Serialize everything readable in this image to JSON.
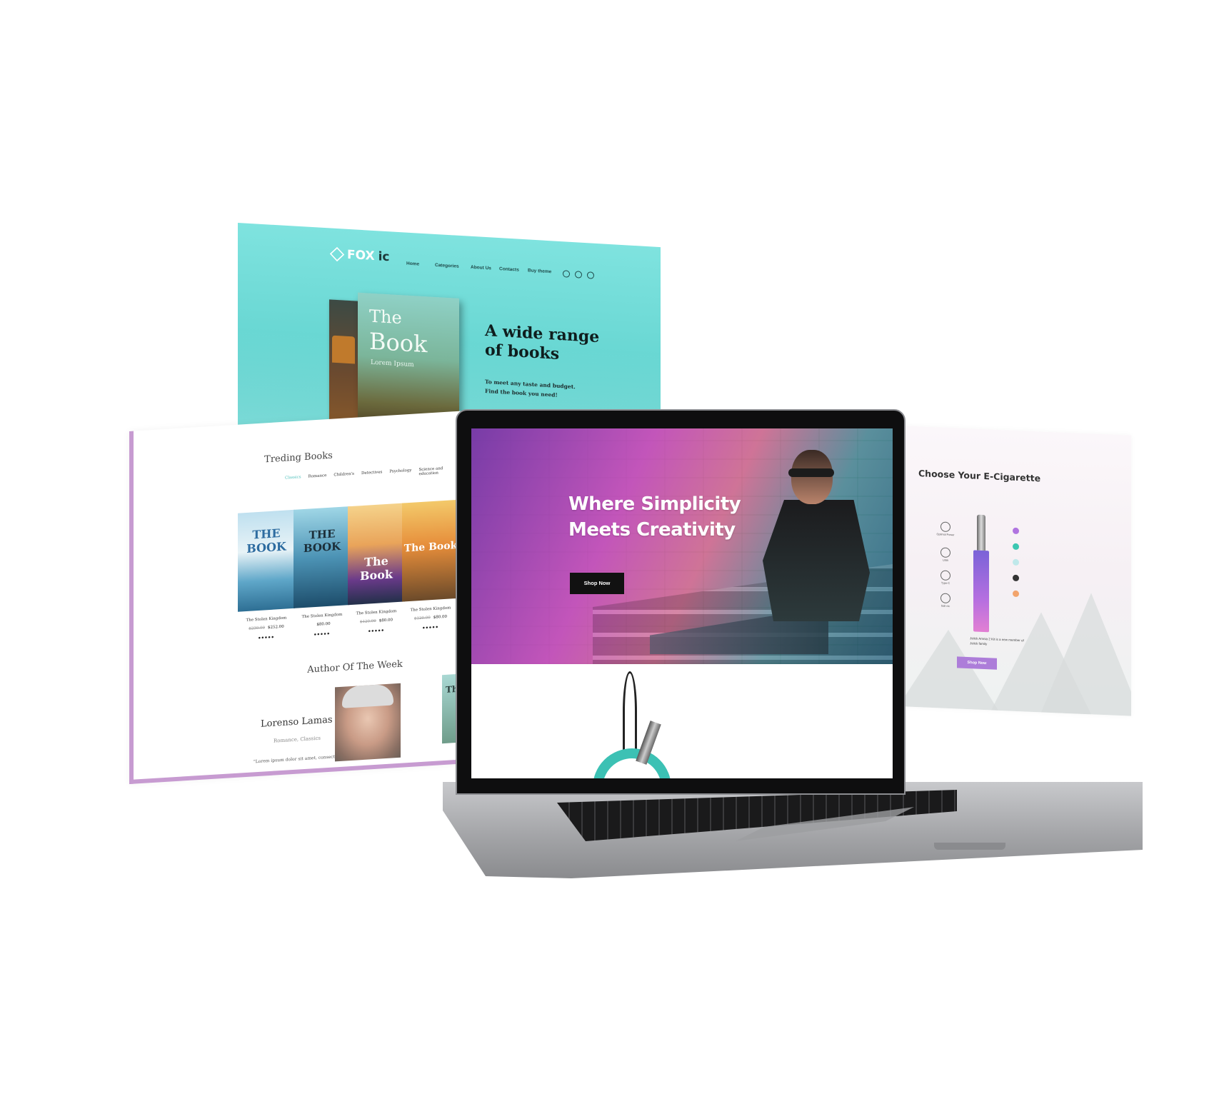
{
  "hero_panel": {
    "logo": {
      "text": "FOX",
      "suffix": "ic"
    },
    "nav": [
      "Home",
      "Categories",
      "About Us",
      "Contacts",
      "Buy theme"
    ],
    "book_cover": {
      "line1": "The",
      "line2": "Book",
      "line3": "Lorem Ipsum"
    },
    "headline_line1": "A wide range",
    "headline_line2": "of books",
    "subtext_line1": "To meet any taste and budget.",
    "subtext_line2": "Find the book you need!",
    "colors": {
      "background": "#67d6d2",
      "headline": "#0f1e1e"
    }
  },
  "books_panel": {
    "title": "Treding Books",
    "categories": [
      "Classics",
      "Romance",
      "Children's",
      "Detectives",
      "Psychology",
      "Science and education"
    ],
    "active_category": "Classics",
    "books": [
      {
        "cover_text": "THE BOOK",
        "name": "The Stolen Kingdom",
        "old_price": "$230.00",
        "price": "$252.00",
        "stars": "●●●●●"
      },
      {
        "cover_text": "THE BOOK",
        "name": "The Stolen Kingdom",
        "old_price": "",
        "price": "$80.00",
        "stars": "●●●●●"
      },
      {
        "cover_text": "The Book",
        "name": "The Stolen Kingdom",
        "old_price": "$120.00",
        "price": "$80.00",
        "stars": "●●●●●"
      },
      {
        "cover_text": "The Book",
        "name": "The Stolen Kingdom",
        "old_price": "$120.00",
        "price": "$80.00",
        "stars": "●●●●●"
      }
    ],
    "author_section_title": "Author Of The Week",
    "author_name": "Lorenso Lamas",
    "author_genres": "Romance, Classics",
    "author_quote": "\"Lorem ipsum dolor sit amet, consectetur",
    "mini_book_text": "The",
    "colors": {
      "border": "#c79bd1",
      "active_category": "#4fc0bb"
    }
  },
  "laptop_screen": {
    "headline_line1": "Where Simplicity",
    "headline_line2": "Meets Creativity",
    "button_label": "Shop Now"
  },
  "ecig_panel": {
    "title": "Choose Your E-Cigarette",
    "specs": [
      "Optimal Power",
      "USB",
      "Type-C",
      "Salt nic"
    ],
    "swatches": [
      "#b074e0",
      "#3cc7b1",
      "#bfe8ea",
      "#333333",
      "#f2a46c"
    ],
    "description": "Jstick Amnia 2 Kit is a new member of Jstick family",
    "button_label": "Shop Now",
    "colors": {
      "button": "#ad7dd9"
    }
  }
}
